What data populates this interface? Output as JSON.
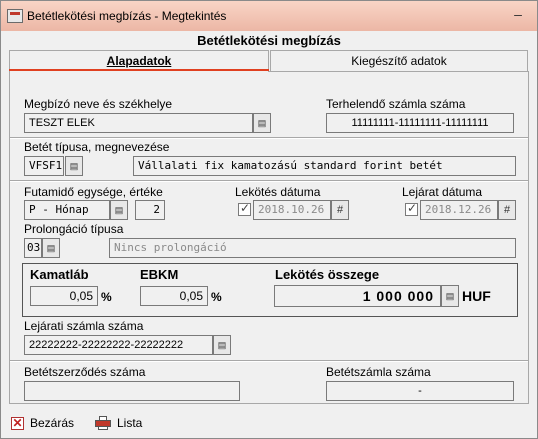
{
  "window": {
    "title": "Betétlekötési megbízás - Megtekintés",
    "minimize_symbol": "–"
  },
  "form": {
    "header": "Betétlekötési megbízás"
  },
  "tabs": {
    "active": "Alapadatok",
    "inactive": "Kiegészítő adatok"
  },
  "client": {
    "label": "Megbízó neve és székhelye",
    "value": "TESZT ELEK",
    "debit_label": "Terhelendő számla száma",
    "debit_value": "11111111-11111111-11111111"
  },
  "deposit_type": {
    "label": "Betét típusa, megnevezése",
    "code": "VFSF1",
    "name": "Vállalati fix kamatozású standard forint betét"
  },
  "term": {
    "label": "Futamidő egysége, értéke",
    "unit": "P - Hónap",
    "value": "2",
    "lock_date_label": "Lekötés dátuma",
    "lock_date": "2018.10.26",
    "maturity_label": "Lejárat dátuma",
    "maturity_date": "2018.12.26",
    "date_button": "#"
  },
  "prolongation": {
    "label": "Prolongáció típusa",
    "code": "03",
    "name": "Nincs prolongáció"
  },
  "rates": {
    "interest_label": "Kamatláb",
    "interest_value": "0,05",
    "interest_unit": "%",
    "ebkm_label": "EBKM",
    "ebkm_value": "0,05",
    "ebkm_unit": "%",
    "amount_label": "Lekötés összege",
    "amount_value": "1 000 000",
    "currency": "HUF"
  },
  "maturity_account": {
    "label": "Lejárati számla száma",
    "value": "22222222-22222222-22222222"
  },
  "contract": {
    "label": "Betétszerződés száma",
    "value": "",
    "account_label": "Betétszámla száma",
    "account_value": "-"
  },
  "footer": {
    "close_label": "Bezárás",
    "list_label": "Lista"
  },
  "icons": {
    "app": "form-icon",
    "lookup": "list-lookup-icon",
    "close": "close-x-icon",
    "print": "printer-icon",
    "accent_color": "#e04020"
  }
}
